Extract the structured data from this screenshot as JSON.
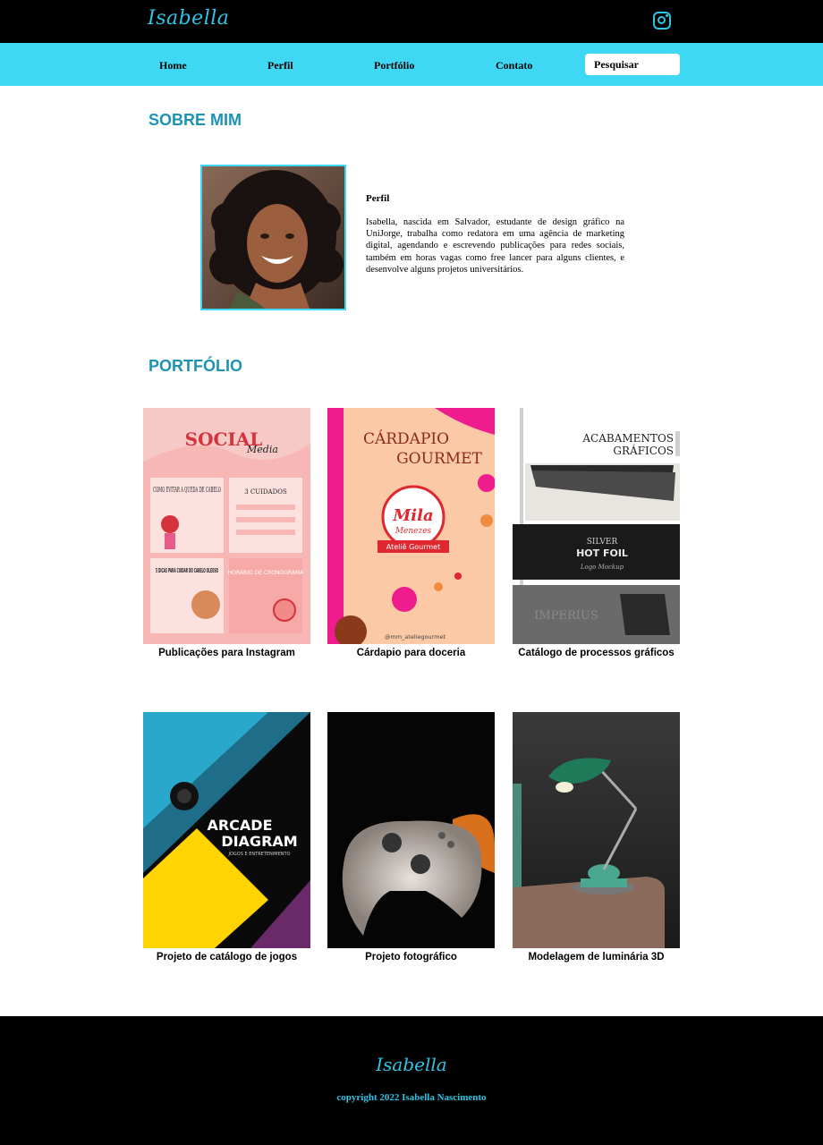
{
  "header": {
    "logo": "Isabella",
    "instagram_icon": "instagram-icon"
  },
  "nav": {
    "items": [
      {
        "label": "Home"
      },
      {
        "label": "Perfil"
      },
      {
        "label": "Portfólio"
      },
      {
        "label": "Contato"
      }
    ],
    "search_placeholder": "Pesquisar"
  },
  "about": {
    "title": "SOBRE MIM",
    "profile_heading": "Perfil",
    "profile_text": "Isabella, nascida em Salvador, estudante de design gráfico na UniJorge, trabalha como redatora em uma agência de marketing digital, agendando e escrevendo publicações para redes sociais, também em horas vagas como free lancer para alguns clientes, e desenvolve alguns projetos universitários."
  },
  "portfolio": {
    "title": "PORTFÓLIO",
    "cards": [
      {
        "caption": "Publicações para Instagram",
        "thumb": {
          "title": "SOCIAL",
          "subtitle": "Media",
          "post1": "COMO EVITAR A QUEDA DE CABELO",
          "post2": "3 CUIDADOS",
          "post3": "5 DICAS PARA CUIDAR DO CABELO OLEOSO",
          "post4": "HORÁRIO DE CRONOGRAMA"
        }
      },
      {
        "caption": "Cárdapio para doceria",
        "thumb": {
          "title_line1": "CÁRDAPIO",
          "title_line2": "GOURMET",
          "brand": "Mila",
          "brand2": "Menezes",
          "ribbon": "Ateliê Gourmet",
          "handle": "@mm_ateliegourmet"
        }
      },
      {
        "caption": "Catálogo de processos gráficos",
        "thumb": {
          "line1": "ACABAMENTOS",
          "line2": "GRÁFICOS",
          "foil1": "SILVER",
          "foil2": "HOT FOIL",
          "foil3": "Logo Mockup",
          "emboss": "IMPERIUS"
        }
      },
      {
        "caption": "Projeto de catálogo de jogos",
        "thumb": {
          "line1": "ARCADE",
          "line2": "DIAGRAM",
          "line3": "JOGOS E ENTRETENIMENTO"
        }
      },
      {
        "caption": "Projeto fotográfico"
      },
      {
        "caption": "Modelagem de luminária 3D"
      }
    ]
  },
  "footer": {
    "logo": "Isabella",
    "copyright": "copyright 2022 Isabella Nascimento"
  },
  "colors": {
    "header_bg": "#000000",
    "nav_bg": "#3ed8f5",
    "accent": "#2ec4e6",
    "title": "#1c93b2"
  }
}
